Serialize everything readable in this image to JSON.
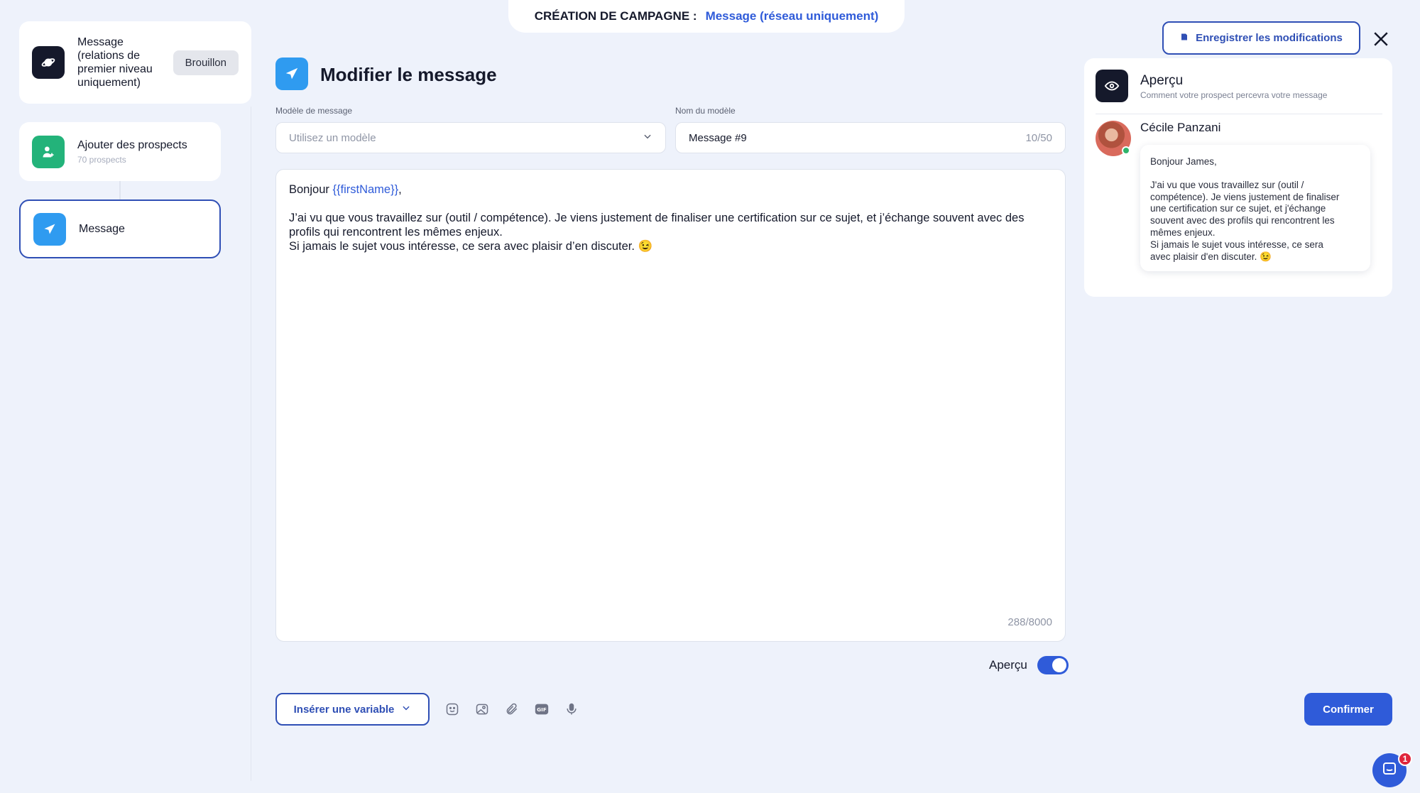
{
  "header": {
    "label": "CRÉATION DE CAMPAGNE :",
    "value": "Message (réseau uniquement)"
  },
  "steps": [
    {
      "title": "Message (relations de premier niveau uniquement)",
      "title_lines": [
        "Message",
        "(relations de",
        "premier niveau",
        "uniquement)"
      ],
      "badge": "Brouillon",
      "icon": "planet-icon"
    },
    {
      "title": "Ajouter des prospects",
      "subtitle": "70 prospects",
      "icon": "add-user-icon"
    },
    {
      "title": "Message",
      "icon": "paper-plane-icon"
    }
  ],
  "main": {
    "title": "Modifier le message",
    "template_label": "Modèle de message",
    "template_placeholder": "Utilisez un modèle",
    "name_label": "Nom du modèle",
    "name_value": "Message #9",
    "name_count": "10/50",
    "editor": {
      "greeting": "Bonjour ",
      "variable": "{{firstName}}",
      "greeting_end": ",",
      "line1": "J’ai vu que vous travaillez sur (outil / compétence). Je viens justement de finaliser une certification sur ce sujet, et j’échange souvent avec des",
      "line2": "profils qui rencontrent les mêmes enjeux.",
      "line3": "Si jamais le sujet vous intéresse, ce sera avec plaisir d’en discuter. 😉",
      "char_count": "288/8000"
    },
    "preview_toggle_label": "Aperçu",
    "preview_toggle_on": true,
    "insert_variable_label": "Insérer une variable",
    "toolbar_icons": [
      "emoji-icon",
      "image-icon",
      "attachment-icon",
      "gif-icon",
      "microphone-icon"
    ],
    "confirm_label": "Confirmer"
  },
  "right": {
    "save_label": "Enregistrer les modifications",
    "preview_title": "Aperçu",
    "preview_subtitle": "Comment votre prospect percevra votre message",
    "contact_name": "Cécile Panzani",
    "bubble": {
      "greeting": "Bonjour James,",
      "lines": [
        "J'ai vu que vous travaillez sur (outil /",
        "compétence). Je viens justement de finaliser",
        "une certification sur ce sujet, et j'échange",
        "souvent avec des profils qui rencontrent les",
        "mêmes enjeux.",
        "Si jamais le sujet vous intéresse, ce sera",
        "avec plaisir d'en discuter. 😉"
      ]
    }
  },
  "chat": {
    "badge_count": "1"
  },
  "colors": {
    "accent": "#2f5bd9",
    "accent_dark": "#2f4fb5",
    "background": "#eef2fb",
    "green": "#23b37a",
    "icon_blue": "#2f9bf0"
  }
}
